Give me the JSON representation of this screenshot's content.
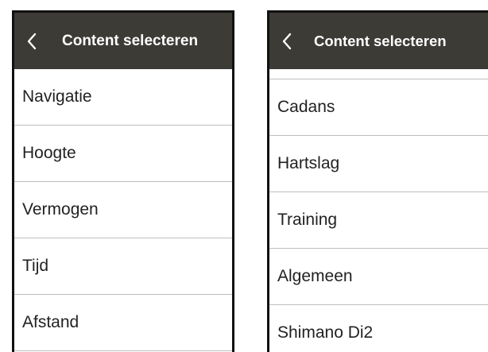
{
  "screens": [
    {
      "header": {
        "title": "Content selecteren",
        "back_icon": "chevron-left-icon"
      },
      "items": [
        {
          "label": "Navigatie"
        },
        {
          "label": "Hoogte"
        },
        {
          "label": "Vermogen"
        },
        {
          "label": "Tijd"
        },
        {
          "label": "Afstand"
        }
      ]
    },
    {
      "header": {
        "title": "Content selecteren",
        "back_icon": "chevron-left-icon"
      },
      "items": [
        {
          "label": "Cadans"
        },
        {
          "label": "Hartslag"
        },
        {
          "label": "Training"
        },
        {
          "label": "Algemeen"
        },
        {
          "label": "Shimano Di2"
        }
      ]
    }
  ],
  "colors": {
    "header_bg": "#3c3b36",
    "header_text": "#ffffff",
    "item_text": "#222222",
    "divider": "#bdbdbd"
  }
}
